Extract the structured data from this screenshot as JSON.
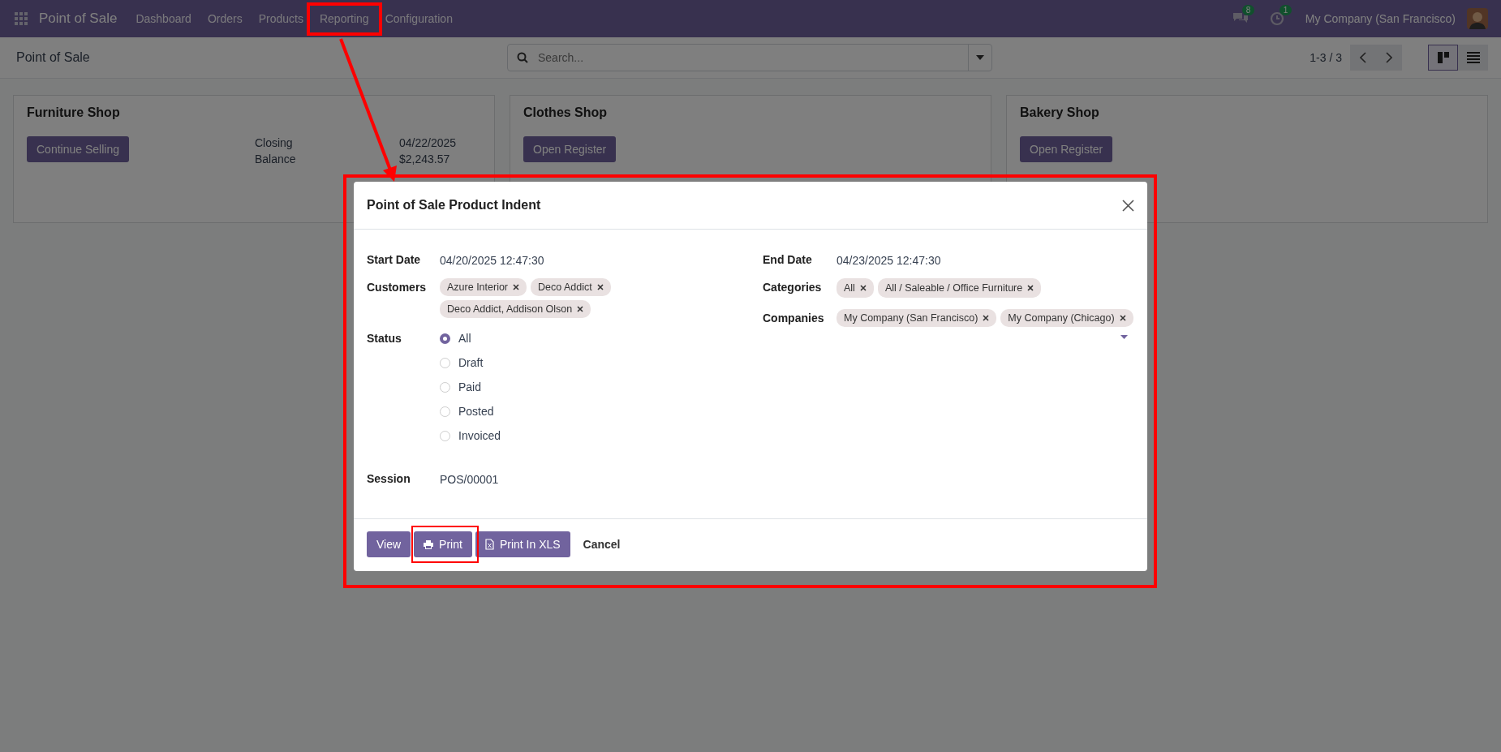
{
  "navbar": {
    "app_title": "Point of Sale",
    "menu": [
      {
        "label": "Dashboard"
      },
      {
        "label": "Orders"
      },
      {
        "label": "Products"
      },
      {
        "label": "Reporting"
      },
      {
        "label": "Configuration"
      }
    ],
    "messages_badge": "8",
    "activities_badge": "1",
    "company": "My Company (San Francisco)"
  },
  "control_panel": {
    "breadcrumb": "Point of Sale",
    "search": {
      "placeholder": "Search..."
    },
    "pager": "1-3 / 3",
    "views": [
      {
        "kind": "kanban",
        "selected": true
      },
      {
        "kind": "list",
        "selected": false
      }
    ]
  },
  "shops": [
    {
      "name": "Furniture Shop",
      "button": "Continue Selling",
      "details": [
        {
          "label": "Closing",
          "value": "04/22/2025"
        },
        {
          "label": "Balance",
          "value": "$2,243.57"
        }
      ]
    },
    {
      "name": "Clothes Shop",
      "button": "Open Register"
    },
    {
      "name": "Bakery Shop",
      "button": "Open Register"
    }
  ],
  "dialog": {
    "title": "Point of Sale Product Indent",
    "start_date": {
      "label": "Start Date",
      "value": "04/20/2025 12:47:30"
    },
    "customers": {
      "label": "Customers",
      "tags": [
        "Azure Interior",
        "Deco Addict",
        "Deco Addict, Addison Olson"
      ]
    },
    "status": {
      "label": "Status",
      "options": [
        {
          "label": "All",
          "selected": true
        },
        {
          "label": "Draft",
          "selected": false
        },
        {
          "label": "Paid",
          "selected": false
        },
        {
          "label": "Posted",
          "selected": false
        },
        {
          "label": "Invoiced",
          "selected": false
        }
      ]
    },
    "session": {
      "label": "Session",
      "value": "POS/00001"
    },
    "end_date": {
      "label": "End Date",
      "value": "04/23/2025 12:47:30"
    },
    "categories": {
      "label": "Categories",
      "tags": [
        "All",
        "All / Saleable / Office Furniture"
      ]
    },
    "companies": {
      "label": "Companies",
      "tags": [
        "My Company (San Francisco)",
        "My Company (Chicago)"
      ]
    },
    "buttons": [
      {
        "label": "View",
        "kind": "view"
      },
      {
        "label": "Print",
        "kind": "print"
      },
      {
        "label": "Print In XLS",
        "kind": "spreadsheet"
      },
      {
        "label": "Cancel",
        "kind": "cancel"
      }
    ]
  }
}
